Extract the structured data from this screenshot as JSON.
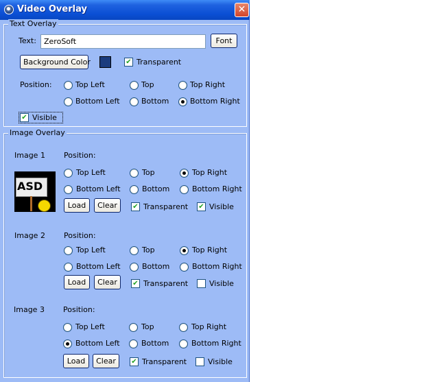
{
  "window": {
    "title": "Video Overlay",
    "close_glyph": "✕"
  },
  "text_overlay": {
    "legend": "Text Overlay",
    "text_label": "Text:",
    "text_value": "ZeroSoft",
    "font_button": "Font",
    "background_color_button": "Background Color",
    "background_color": "#1b3c7e",
    "transparent_label": "Transparent",
    "transparent_checked": true,
    "position_label": "Position:",
    "positions": [
      "Top Left",
      "Top",
      "Top Right",
      "Bottom Left",
      "Bottom",
      "Bottom Right"
    ],
    "selected_position": "Bottom Right",
    "visible_label": "Visible",
    "visible_checked": true
  },
  "image_overlay": {
    "legend": "Image Overlay",
    "position_label": "Position:",
    "positions": [
      "Top Left",
      "Top",
      "Top Right",
      "Bottom Left",
      "Bottom",
      "Bottom Right"
    ],
    "load_button": "Load",
    "clear_button": "Clear",
    "transparent_label": "Transparent",
    "visible_label": "Visible",
    "images": [
      {
        "label": "Image 1",
        "selected": "Top Right",
        "transparent": true,
        "visible": true,
        "thumb_text": "ASD"
      },
      {
        "label": "Image 2",
        "selected": "Top Right",
        "transparent": true,
        "visible": false
      },
      {
        "label": "Image 3",
        "selected": "Bottom Left",
        "transparent": true,
        "visible": false
      }
    ]
  }
}
